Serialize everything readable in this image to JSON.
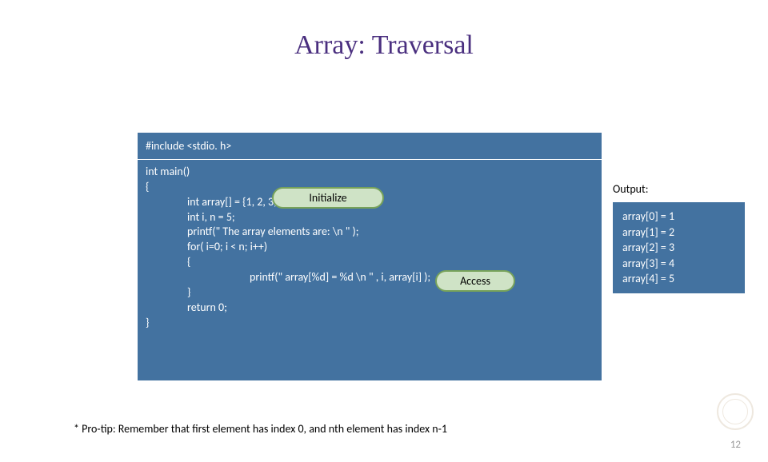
{
  "title": "Array: Traversal",
  "code": {
    "include": "#include <stdio. h>",
    "main_sig": "int main()",
    "brace_open": "{",
    "line_arr": "int array[] = {1, 2, 3, 4, 5};",
    "line_in": "int i, n = 5;",
    "line_printf1": "printf(\" The array elements are: \\n \" );",
    "line_for": "for( i=0; i < n; i++)",
    "line_for_open": "{",
    "line_printf2": "printf(\" array[%d] = %d \\n \" , i, array[i] );",
    "line_for_close": "}",
    "line_return": "return 0;",
    "brace_close": "}"
  },
  "callouts": {
    "initialize": "Initialize",
    "access": "Access"
  },
  "output": {
    "label": "Output:",
    "lines": [
      "array[0] = 1",
      "array[1] = 2",
      "array[2] = 3",
      "array[3] = 4",
      "array[4] = 5"
    ]
  },
  "protip": "* Pro-tip: Remember that first element has index 0, and nth element has index n-1",
  "slidenum": "12"
}
